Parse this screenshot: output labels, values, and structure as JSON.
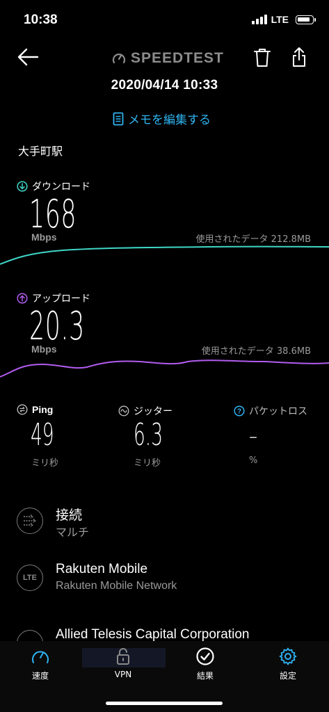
{
  "status_bar": {
    "time": "10:38",
    "network": "LTE"
  },
  "header": {
    "brand": "SPEEDTEST"
  },
  "result": {
    "datetime": "2020/04/14 10:33",
    "memo_label": "メモを編集する",
    "location": "大手町駅"
  },
  "download": {
    "label": "ダウンロード",
    "value": "168",
    "unit": "Mbps",
    "used_data": "使用されたデータ 212.8MB"
  },
  "upload": {
    "label": "アップロード",
    "value": "20.3",
    "unit": "Mbps",
    "used_data": "使用されたデータ 38.6MB"
  },
  "ping": {
    "label": "Ping",
    "value": "49",
    "unit": "ミリ秒"
  },
  "jitter": {
    "label": "ジッター",
    "value": "6.3",
    "unit": "ミリ秒"
  },
  "packet_loss": {
    "label": "パケットロス",
    "value": "–",
    "unit": "%"
  },
  "connection": {
    "title": "接続",
    "subtitle": "マルチ"
  },
  "provider": {
    "icon_text": "LTE",
    "title": "Rakuten Mobile",
    "subtitle": "Rakuten Mobile Network"
  },
  "server": {
    "title": "Allied Telesis Capital Corporation"
  },
  "tabs": [
    {
      "label": "速度",
      "icon": "speedometer-icon"
    },
    {
      "label": "VPN",
      "icon": "lock-icon"
    },
    {
      "label": "結果",
      "icon": "check-circle-icon"
    },
    {
      "label": "設定",
      "icon": "gear-icon"
    }
  ],
  "colors": {
    "download_graph": "#3fd7c8",
    "upload_graph": "#b25cf0",
    "accent_blue": "#2fb3f0",
    "secondary_text": "#9a9a9a"
  }
}
